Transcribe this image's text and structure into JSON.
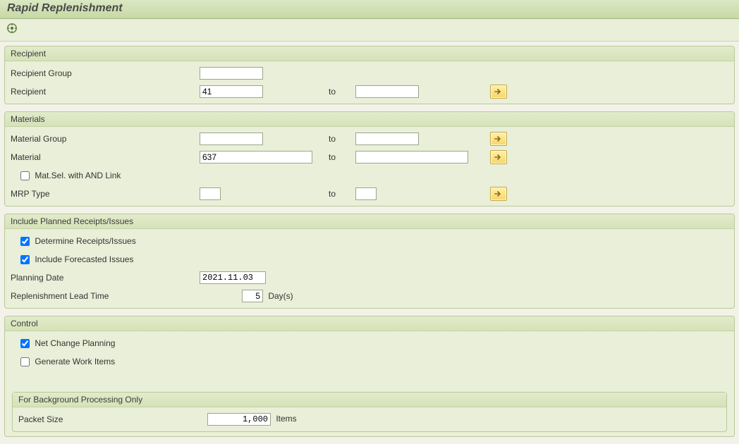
{
  "title": "Rapid Replenishment",
  "groups": {
    "recipient": {
      "title": "Recipient",
      "rows": {
        "group": {
          "label": "Recipient Group",
          "from": "",
          "to_label": "",
          "to": ""
        },
        "recip": {
          "label": "Recipient",
          "from": "41",
          "to_label": "to",
          "to": ""
        }
      }
    },
    "materials": {
      "title": "Materials",
      "rows": {
        "mgroup": {
          "label": "Material Group",
          "from": "",
          "to_label": "to",
          "to": ""
        },
        "material": {
          "label": "Material",
          "from": "637",
          "to_label": "to",
          "to": ""
        },
        "andlink": {
          "label": "Mat.Sel. with AND Link",
          "checked": false
        },
        "mrptype": {
          "label": "MRP Type",
          "from": "",
          "to_label": "to",
          "to": ""
        }
      }
    },
    "planned": {
      "title": "Include Planned Receipts/Issues",
      "rows": {
        "determine": {
          "label": "Determine Receipts/Issues",
          "checked": true
        },
        "forecast": {
          "label": "Include Forecasted Issues",
          "checked": true
        },
        "pdate": {
          "label": "Planning Date",
          "value": "2021.11.03"
        },
        "rlt": {
          "label": "Replenishment Lead Time",
          "value": "5",
          "unit": "Day(s)"
        }
      }
    },
    "control": {
      "title": "Control",
      "rows": {
        "netchange": {
          "label": "Net Change Planning",
          "checked": true
        },
        "workitems": {
          "label": "Generate Work Items",
          "checked": false
        }
      },
      "bg": {
        "title": "For Background Processing Only",
        "packet": {
          "label": "Packet Size",
          "value": "1,000",
          "unit": "Items"
        }
      }
    }
  }
}
